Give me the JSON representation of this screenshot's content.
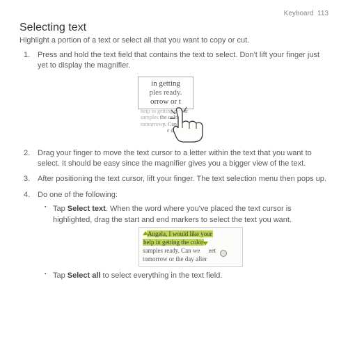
{
  "header": {
    "section": "Keyboard",
    "page": "113"
  },
  "title": "Selecting text",
  "intro": "Highlight a portion of a text or select all that you want to copy or cut.",
  "steps": {
    "s1": "Press and hold the text field that contains the text to select. Don't lift your finger just yet to display the magnifier.",
    "s2": "Drag your finger to move the text cursor to a letter within the text that you want to select. It should be easy since the magnifier gives you a bigger view of the text.",
    "s3": "After positioning the text cursor, lift your finger. The text selection menu then pops up.",
    "s4": "Do one of the following:",
    "sub1a": "Tap ",
    "sub1b": "Select text",
    "sub1c": ". When the word where you've placed the text cursor is highlighted, drag the start and end markers to select the text you want.",
    "sub2a": "Tap ",
    "sub2b": "Select all",
    "sub2c": " to select everything in the text field."
  },
  "fig1": {
    "mag_line1": "in getting",
    "mag_line2": "ples ready.",
    "mag_line3": "orrow or t",
    "bg_line1_a": "help in getting ",
    "bg_line1_b": "e your",
    "bg_line2_a": "samples ",
    "bg_line2_b": "the color",
    "bg_line3_a": "tomorrow",
    "bg_line3_b": "y. Can we meet",
    "bg_line4": "e day after"
  },
  "fig2": {
    "pre": "Angela, I would like your",
    "hl": "help in getting the color",
    "post1": "samples ready. Can we ",
    "post1b": "eet",
    "post2": "tomorrow or the day after"
  }
}
